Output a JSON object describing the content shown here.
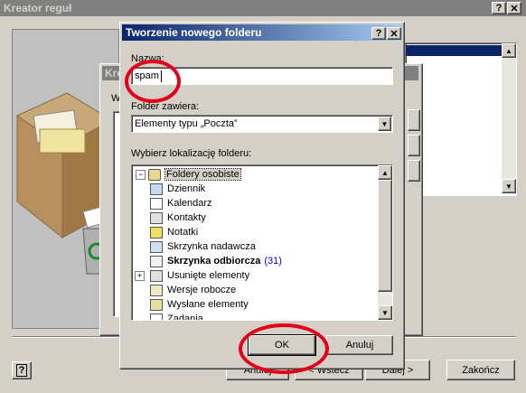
{
  "wizard": {
    "title": "Kreator reguł",
    "help_btn": "?",
    "close_btn": "✕",
    "behind_title": "Kre",
    "behind_label": "W",
    "buttons": {
      "back": "< Wstecz",
      "next": "Dalej >",
      "finish": "Zakończ",
      "cancel": "Anuluj"
    }
  },
  "dialog": {
    "title": "Tworzenie nowego folderu",
    "help_btn": "?",
    "close_btn": "✕",
    "name_label": "Nazwa:",
    "name_value": "spam",
    "contains_label": "Folder zawiera:",
    "contains_value": "Elementy typu „Poczta”",
    "location_label": "Wybierz lokalizację folderu:",
    "tree": {
      "root": "Foldery osobiste",
      "items": [
        {
          "label": "Dziennik",
          "icon": "journal-icon"
        },
        {
          "label": "Kalendarz",
          "icon": "calendar-icon"
        },
        {
          "label": "Kontakty",
          "icon": "contacts-icon"
        },
        {
          "label": "Notatki",
          "icon": "notes-icon"
        },
        {
          "label": "Skrzynka nadawcza",
          "icon": "outbox-icon"
        },
        {
          "label": "Skrzynka odbiorcza",
          "icon": "inbox-icon",
          "count": "(31)",
          "bold": true
        },
        {
          "label": "Usunięte elementy",
          "icon": "deleted-items-icon",
          "expandable": true
        },
        {
          "label": "Wersje robocze",
          "icon": "drafts-icon"
        },
        {
          "label": "Wysłane elementy",
          "icon": "sent-items-icon"
        },
        {
          "label": "Zadania",
          "icon": "tasks-icon"
        }
      ]
    },
    "ok": "OK",
    "cancel": "Anuluj"
  },
  "colors": {
    "annotation_red": "#e4001b",
    "title_blue": "#0a246a",
    "count_blue": "#0000ff"
  }
}
